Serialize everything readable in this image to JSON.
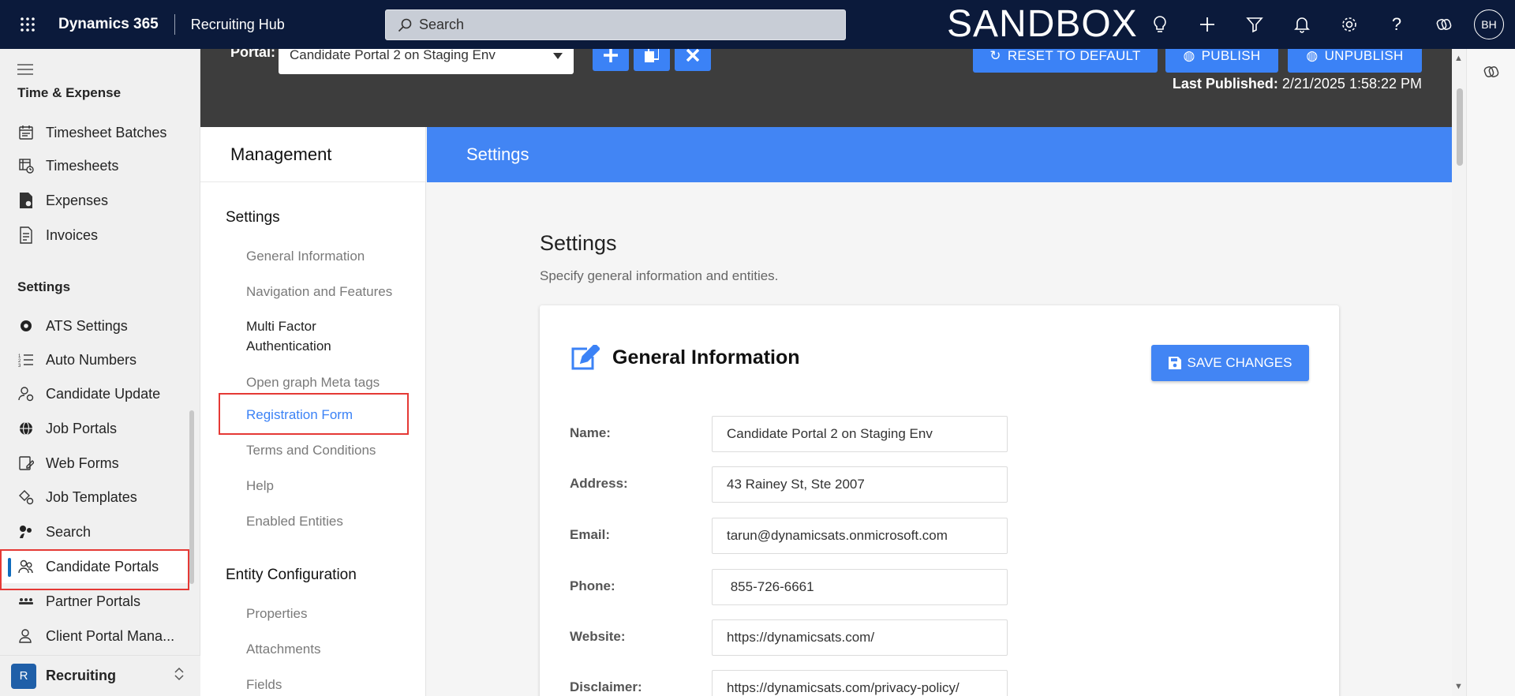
{
  "topbar": {
    "app_name": "Dynamics 365",
    "hub_name": "Recruiting Hub",
    "search_placeholder": "Search",
    "environment_label": "SANDBOX",
    "avatar_initials": "BH"
  },
  "leftnav": {
    "section_time": "Time & Expense",
    "items_time": [
      {
        "label": "Timesheet Batches",
        "icon": "calendar-list-icon"
      },
      {
        "label": "Timesheets",
        "icon": "timesheet-icon"
      },
      {
        "label": "Expenses",
        "icon": "expense-document-icon"
      },
      {
        "label": "Invoices",
        "icon": "invoice-icon"
      }
    ],
    "section_settings": "Settings",
    "items_settings": [
      {
        "label": "ATS Settings",
        "icon": "gear-icon"
      },
      {
        "label": "Auto Numbers",
        "icon": "numbered-list-icon"
      },
      {
        "label": "Candidate Update",
        "icon": "person-sync-icon"
      },
      {
        "label": "Job Portals",
        "icon": "globe-icon"
      },
      {
        "label": "Web Forms",
        "icon": "form-edit-icon"
      },
      {
        "label": "Job Templates",
        "icon": "template-icon"
      },
      {
        "label": "Search",
        "icon": "search-people-icon"
      },
      {
        "label": "Candidate Portals",
        "icon": "people-icon"
      },
      {
        "label": "Partner Portals",
        "icon": "people-group-icon"
      },
      {
        "label": "Client Portal Mana...",
        "icon": "person-shield-icon"
      }
    ],
    "area": {
      "badge": "R",
      "label": "Recruiting"
    }
  },
  "header": {
    "portal_label": "Portal:",
    "portal_value": "Candidate Portal 2 on Staging Env",
    "reset_label": "RESET TO DEFAULT",
    "publish_label": "PUBLISH",
    "unpublish_label": "UNPUBLISH",
    "last_published_label": "Last Published:",
    "last_published_value": "2/21/2025 1:58:22 PM"
  },
  "management": {
    "title": "Management",
    "group_settings": "Settings",
    "settings_items": [
      "General Information",
      "Navigation and Features",
      "Multi Factor Authentication",
      "Open graph Meta tags",
      "Registration Form",
      "Terms and Conditions",
      "Help",
      "Enabled Entities"
    ],
    "group_entity": "Entity Configuration",
    "entity_items": [
      "Properties",
      "Attachments",
      "Fields"
    ]
  },
  "settings": {
    "banner": "Settings",
    "title": "Settings",
    "subtitle": "Specify general information and entities.",
    "card_title": "General Information",
    "save_label": "SAVE CHANGES",
    "fields": [
      {
        "label": "Name:",
        "value": "Candidate Portal 2 on Staging Env"
      },
      {
        "label": "Address:",
        "value": "43 Rainey St, Ste 2007"
      },
      {
        "label": "Email:",
        "value": "tarun@dynamicsats.onmicrosoft.com"
      },
      {
        "label": "Phone:",
        "value": " 855-726-6661"
      },
      {
        "label": "Website:",
        "value": "https://dynamicsats.com/"
      },
      {
        "label": "Disclaimer:",
        "value": "https://dynamicsats.com/privacy-policy/"
      }
    ]
  },
  "colors": {
    "topbar": "#0b1a3b",
    "accent_blue": "#4285f4",
    "highlight_red": "#e53935",
    "dark_header": "#3d3d3d"
  }
}
